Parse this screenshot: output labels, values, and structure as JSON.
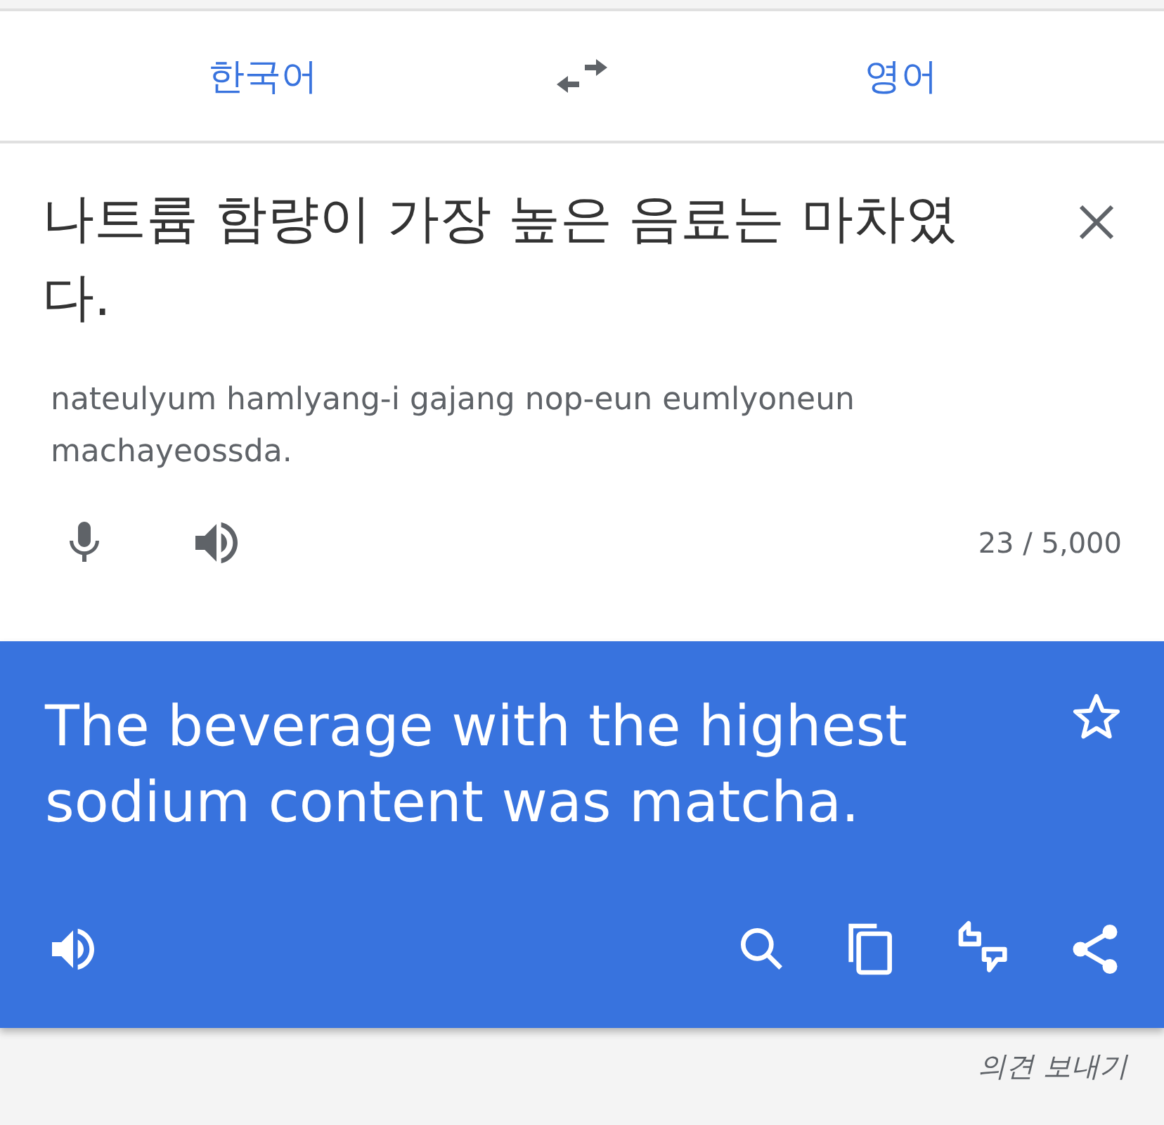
{
  "languages": {
    "source": "한국어",
    "target": "영어"
  },
  "input": {
    "text": "나트륨 함량이 가장 높은 음료는 마차였다.",
    "romanization": "nateulyum hamlyang-i gajang nop-eun eumlyoneun machayeossda.",
    "char_count": "23 / 5,000"
  },
  "translation": {
    "text": "The beverage with the highest sodium content was matcha.",
    "starred": false
  },
  "feedback": "의견 보내기"
}
